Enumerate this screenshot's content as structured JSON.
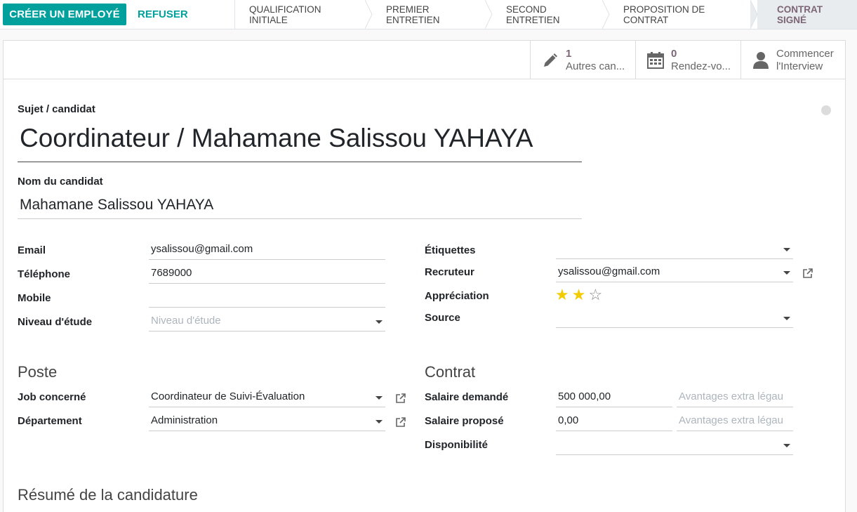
{
  "statusbar": {
    "create_employee": "CRÉER UN EMPLOYÉ",
    "refuse": "REFUSER",
    "stages": [
      "QUALIFICATION INITIALE",
      "PREMIER ENTRETIEN",
      "SECOND ENTRETIEN",
      "PROPOSITION DE CONTRAT",
      "CONTRAT SIGNÉ"
    ],
    "active_stage": "CONTRAT SIGNÉ"
  },
  "smart_buttons": {
    "others": {
      "count": "1",
      "label": "Autres can..."
    },
    "meetings": {
      "count": "0",
      "label": "Rendez-vo..."
    },
    "interview": {
      "line1": "Commencer",
      "line2": "l'Interview"
    }
  },
  "form": {
    "subject_label": "Sujet / candidat",
    "subject_value": "Coordinateur / Mahamane Salissou YAHAYA",
    "name_label": "Nom du candidat",
    "name_value": "Mahamane Salissou YAHAYA",
    "email_label": "Email",
    "email_value": "ysalissou@gmail.com",
    "phone_label": "Téléphone",
    "phone_value": "7689000",
    "mobile_label": "Mobile",
    "mobile_value": "",
    "level_label": "Niveau d'étude",
    "level_placeholder": "Niveau d'étude",
    "tags_label": "Étiquettes",
    "recruiter_label": "Recruteur",
    "recruiter_value": "ysalissou@gmail.com",
    "rating_label": "Appréciation",
    "rating": {
      "value": 2,
      "max": 3
    },
    "source_label": "Source",
    "poste_section": "Poste",
    "job_label": "Job concerné",
    "job_value": "Coordinateur de Suivi-Évaluation",
    "dept_label": "Département",
    "dept_value": "Administration",
    "contract_section": "Contrat",
    "salary_expected_label": "Salaire demandé",
    "salary_expected_value": "500 000,00",
    "salary_expected_extra_placeholder": "Avantages extra légau",
    "salary_proposed_label": "Salaire proposé",
    "salary_proposed_value": "0,00",
    "salary_proposed_extra_placeholder": "Avantages extra légau",
    "availability_label": "Disponibilité",
    "summary_section": "Résumé de la candidature"
  },
  "colors": {
    "primary": "#00a09d",
    "stage_active": "#7c6576",
    "star": "#f3cc00"
  }
}
